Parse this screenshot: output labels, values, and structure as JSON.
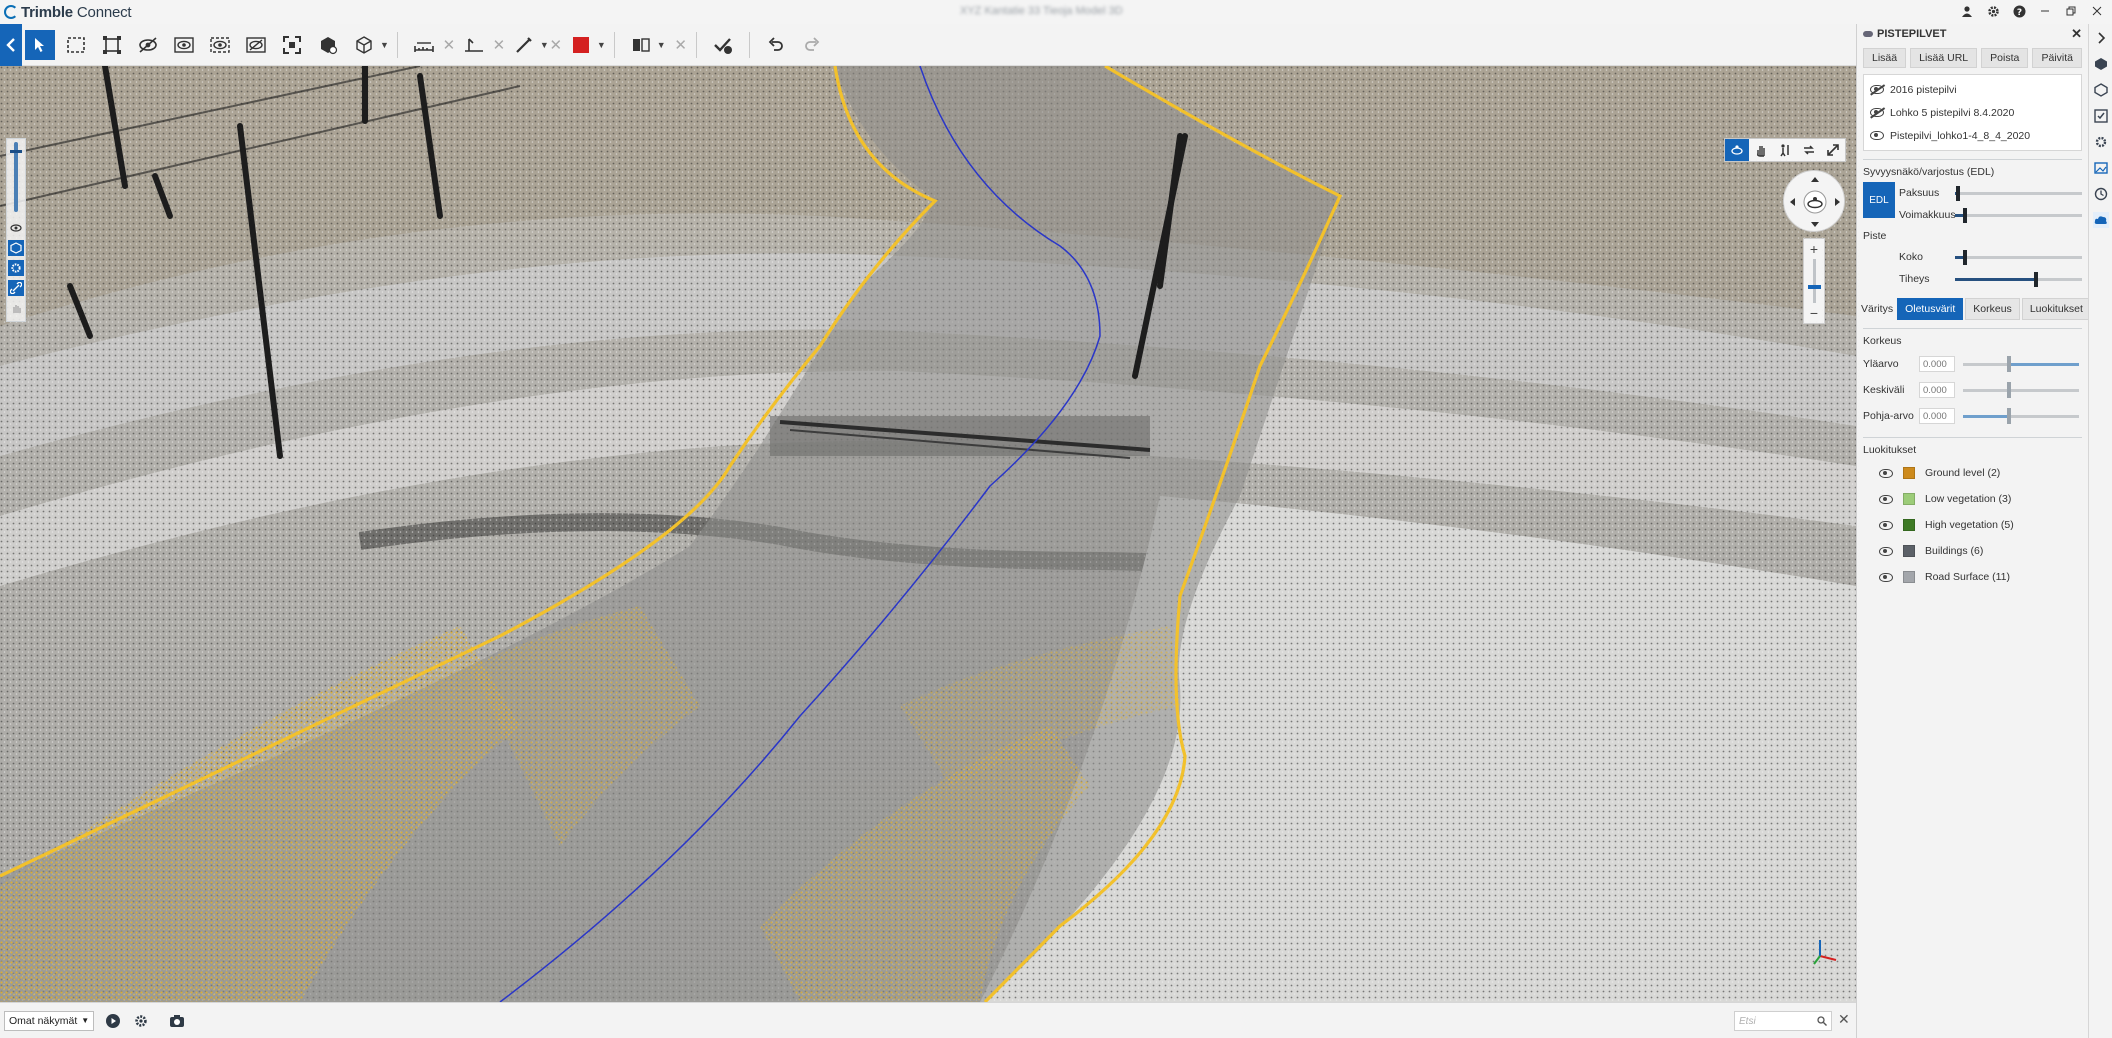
{
  "app": {
    "brand_bold": "Trimble",
    "brand_rest": " Connect",
    "document_title": "XYZ Kantatie 33 Tieoja Model 3D"
  },
  "colors": {
    "accent": "#1565b8",
    "boundary_yellow": "#f2c12c",
    "centerline_blue": "#2a36c8",
    "annotation_red": "#d42020"
  },
  "toolbar": {
    "tools": [
      "back-icon",
      "select-icon",
      "box-select-icon",
      "fit-selection-icon",
      "hide-icon",
      "isolate-icon",
      "show-all-icon",
      "hide-others-icon",
      "fit-all-icon",
      "model-tree-icon",
      "view-cube-icon",
      "measure-icon",
      "measure-point-icon",
      "markup-line-icon",
      "color-icon",
      "section-icon",
      "clash-icon",
      "undo-icon",
      "redo-icon"
    ]
  },
  "viewport": {
    "nav_tools": [
      "orbit-icon",
      "pan-icon",
      "walk-icon",
      "rotate-icon",
      "fullscreen-icon"
    ],
    "zoom_plus": "+",
    "zoom_minus": "−"
  },
  "pointclouds_panel": {
    "title": "PISTEPILVET",
    "buttons": {
      "add": "Lisää",
      "add_url": "Lisää URL",
      "remove": "Poista",
      "refresh": "Päivitä"
    },
    "items": [
      {
        "label": "2016 pistepilvi",
        "visible": false
      },
      {
        "label": "Lohko 5 pistepilvi 8.4.2020",
        "visible": false
      },
      {
        "label": "Pistepilvi_lohko1-4_8_4_2020",
        "visible": true
      }
    ],
    "edl": {
      "title": "Syvyysnäkö/varjostus (EDL)",
      "button": "EDL",
      "thickness_label": "Paksuus",
      "thickness_value": 0.02,
      "strength_label": "Voimakkuus",
      "strength_value": 0.08
    },
    "point": {
      "title": "Piste",
      "size_label": "Koko",
      "size_value": 0.08,
      "density_label": "Tiheys",
      "density_value": 0.64
    },
    "coloring": {
      "label": "Väritys",
      "tabs": [
        "Oletusvärit",
        "Korkeus",
        "Luokitukset"
      ],
      "active_tab": 0
    },
    "height": {
      "title": "Korkeus",
      "rows": [
        {
          "label": "Yläarvo",
          "placeholder": "0.000",
          "value": 0.4
        },
        {
          "label": "Keskiväli",
          "placeholder": "0.000",
          "value": 0.4
        },
        {
          "label": "Pohja-arvo",
          "placeholder": "0.000",
          "value": 0.4
        }
      ]
    },
    "classifications": {
      "title": "Luokitukset",
      "items": [
        {
          "label": "Ground level (2)",
          "color": "#cd8a1c"
        },
        {
          "label": "Low vegetation (3)",
          "color": "#9ccc78"
        },
        {
          "label": "High vegetation (5)",
          "color": "#3e7a25"
        },
        {
          "label": "Buildings (6)",
          "color": "#5c6168"
        },
        {
          "label": "Road Surface (11)",
          "color": "#a3a6ab"
        }
      ]
    }
  },
  "rail_icons": [
    "layers-icon",
    "objects-icon",
    "properties-icon",
    "todo-icon",
    "settings-icon",
    "views-icon",
    "clock-icon",
    "pointcloud-icon"
  ],
  "bottombar": {
    "views_select": "Omat näkymät",
    "search_placeholder": "Etsi"
  }
}
